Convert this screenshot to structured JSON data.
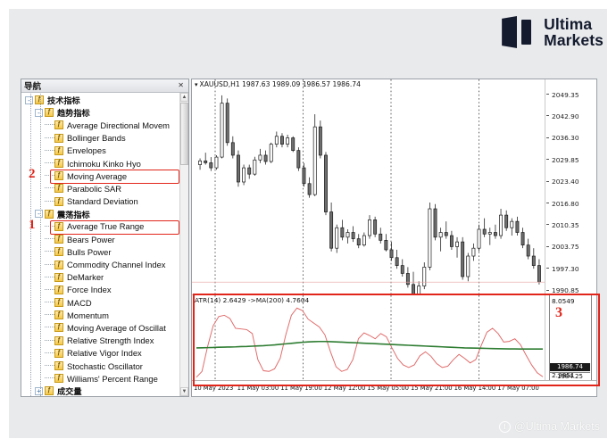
{
  "brand": {
    "name_line1": "Ultima",
    "name_line2": "Markets",
    "logo_color": "#141b2e",
    "watermark_text": "@Ultima Markets",
    "watermark_icon": "facebook-icon",
    "watermark_glyph": "f"
  },
  "navigator": {
    "title": "导航",
    "close_label": "✕",
    "scroll_up": "▲",
    "scroll_down": "▼",
    "tree": [
      {
        "label": "技术指标",
        "level": 0,
        "zh": true,
        "expander": "-"
      },
      {
        "label": "趋势指标",
        "level": 1,
        "zh": true,
        "expander": "-"
      },
      {
        "label": "Average Directional Movem",
        "level": 2,
        "zh": false
      },
      {
        "label": "Bollinger Bands",
        "level": 2,
        "zh": false
      },
      {
        "label": "Envelopes",
        "level": 2,
        "zh": false
      },
      {
        "label": "Ichimoku Kinko Hyo",
        "level": 2,
        "zh": false
      },
      {
        "label": "Moving Average",
        "level": 2,
        "zh": false,
        "highlight": 2
      },
      {
        "label": "Parabolic SAR",
        "level": 2,
        "zh": false
      },
      {
        "label": "Standard Deviation",
        "level": 2,
        "zh": false
      },
      {
        "label": "震荡指标",
        "level": 1,
        "zh": true,
        "expander": "-"
      },
      {
        "label": "Average True Range",
        "level": 2,
        "zh": false,
        "highlight": 1
      },
      {
        "label": "Bears Power",
        "level": 2,
        "zh": false
      },
      {
        "label": "Bulls Power",
        "level": 2,
        "zh": false
      },
      {
        "label": "Commodity Channel Index",
        "level": 2,
        "zh": false
      },
      {
        "label": "DeMarker",
        "level": 2,
        "zh": false
      },
      {
        "label": "Force Index",
        "level": 2,
        "zh": false
      },
      {
        "label": "MACD",
        "level": 2,
        "zh": false
      },
      {
        "label": "Momentum",
        "level": 2,
        "zh": false
      },
      {
        "label": "Moving Average of Oscillat",
        "level": 2,
        "zh": false
      },
      {
        "label": "Relative Strength Index",
        "level": 2,
        "zh": false
      },
      {
        "label": "Relative Vigor Index",
        "level": 2,
        "zh": false
      },
      {
        "label": "Stochastic Oscillator",
        "level": 2,
        "zh": false
      },
      {
        "label": "Williams' Percent Range",
        "level": 2,
        "zh": false
      },
      {
        "label": "成交量",
        "level": 1,
        "zh": true,
        "expander": "+"
      }
    ]
  },
  "annotations": {
    "one": "1",
    "two": "2",
    "three": "3",
    "color": "#e1251b"
  },
  "chart_data": {
    "type": "line",
    "title": "XAUUSD,H1  1987.63 1989.09 1986.57 1986.74",
    "symbol": "XAUUSD",
    "timeframe": "H1",
    "ohlc": {
      "open": "1987.63",
      "high": "1989.09",
      "low": "1986.57",
      "close": "1986.74"
    },
    "caret": "▾",
    "xlabel": "",
    "ylabel": "",
    "grid": true,
    "legend_position": "top-left",
    "price_axis": {
      "ticks": [
        "2049.35",
        "2042.90",
        "2036.30",
        "2029.85",
        "2023.40",
        "2016.80",
        "2010.35",
        "2003.75",
        "1997.30",
        "1990.85"
      ],
      "current_price": "1986.74",
      "next_level": "1984.25",
      "ylim": [
        1984.25,
        2049.35
      ]
    },
    "time_axis": {
      "labels": [
        "10 May 2023",
        "11 May 03:00",
        "11 May 19:00",
        "12 May 12:00",
        "15 May 05:00",
        "15 May 21:00",
        "16 May 14:00",
        "17 May 07:00"
      ]
    },
    "subwindow": {
      "label": "ATR(14) 2.6429  ->MA(200) 4.7604",
      "indicator": "ATR",
      "period": "14",
      "atr_value": "2.6429",
      "ma_label": "MA(200)",
      "ma_value": "4.7604",
      "scale_top": "8.0549",
      "scale_bottom": "2.3851",
      "ylim": [
        2.3851,
        8.0549
      ],
      "series": [
        {
          "name": "ATR(14)",
          "color": "#e06666",
          "values": [
            2.6,
            3.05,
            4.95,
            6.55,
            7.25,
            7.35,
            7.1,
            6.35,
            6.3,
            6.25,
            5.95,
            3.95,
            3.1,
            3.05,
            3.25,
            4.05,
            5.85,
            7.35,
            7.9,
            7.7,
            7.05,
            6.75,
            6.45,
            5.85,
            4.55,
            3.4,
            3.05,
            3.2,
            3.95,
            5.55,
            6.0,
            5.8,
            5.55,
            5.95,
            5.7,
            4.85,
            4.05,
            3.55,
            3.35,
            3.55,
            4.25,
            4.55,
            4.2,
            3.65,
            3.35,
            3.45,
            3.95,
            4.35,
            4.05,
            3.7,
            3.95,
            5.05,
            6.05,
            6.35,
            5.95,
            5.3,
            5.35,
            5.55,
            5.1,
            4.3,
            3.55,
            2.95,
            2.64
          ]
        },
        {
          "name": "MA(200)",
          "color": "#2e7d32",
          "values": [
            4.85,
            4.86,
            4.87,
            4.88,
            4.9,
            4.91,
            4.92,
            4.93,
            4.95,
            4.96,
            4.98,
            5.0,
            5.02,
            5.05,
            5.08,
            5.12,
            5.16,
            5.2,
            5.24,
            5.28,
            5.31,
            5.33,
            5.34,
            5.34,
            5.33,
            5.31,
            5.29,
            5.27,
            5.25,
            5.23,
            5.21,
            5.19,
            5.17,
            5.15,
            5.13,
            5.11,
            5.09,
            5.07,
            5.05,
            5.03,
            5.01,
            4.99,
            4.97,
            4.95,
            4.93,
            4.91,
            4.89,
            4.87,
            4.85,
            4.84,
            4.83,
            4.82,
            4.81,
            4.8,
            4.79,
            4.78,
            4.77,
            4.77,
            4.76,
            4.76,
            4.76,
            4.76,
            4.76
          ]
        }
      ]
    },
    "candles": [
      [
        2024.0,
        2026.0,
        2022.4,
        2025.2
      ],
      [
        2025.2,
        2027.8,
        2024.0,
        2024.6
      ],
      [
        2024.6,
        2026.4,
        2022.0,
        2023.0
      ],
      [
        2023.0,
        2027.0,
        2022.4,
        2026.4
      ],
      [
        2026.4,
        2046.0,
        2026.0,
        2043.5
      ],
      [
        2043.5,
        2045.0,
        2030.0,
        2031.0
      ],
      [
        2031.0,
        2033.0,
        2026.0,
        2027.0
      ],
      [
        2027.0,
        2028.5,
        2017.0,
        2018.5
      ],
      [
        2018.5,
        2024.0,
        2017.5,
        2023.0
      ],
      [
        2023.0,
        2024.0,
        2019.5,
        2021.0
      ],
      [
        2021.0,
        2026.5,
        2020.5,
        2025.5
      ],
      [
        2025.5,
        2029.0,
        2024.5,
        2027.0
      ],
      [
        2027.0,
        2028.5,
        2024.0,
        2025.0
      ],
      [
        2025.0,
        2031.0,
        2024.5,
        2030.5
      ],
      [
        2030.5,
        2034.5,
        2029.5,
        2033.0
      ],
      [
        2033.0,
        2034.0,
        2029.5,
        2030.5
      ],
      [
        2030.5,
        2033.5,
        2029.5,
        2032.5
      ],
      [
        2032.5,
        2033.0,
        2028.0,
        2028.5
      ],
      [
        2028.5,
        2029.5,
        2022.0,
        2023.0
      ],
      [
        2023.0,
        2024.5,
        2017.0,
        2018.0
      ],
      [
        2018.0,
        2020.0,
        2013.5,
        2014.5
      ],
      [
        2014.5,
        2040.0,
        2014.0,
        2036.0
      ],
      [
        2036.0,
        2038.0,
        2026.0,
        2027.0
      ],
      [
        2027.0,
        2028.0,
        2008.0,
        2009.0
      ],
      [
        2009.0,
        2012.0,
        1996.5,
        1997.5
      ],
      [
        1997.5,
        2005.0,
        1996.0,
        2004.0
      ],
      [
        2004.0,
        2006.5,
        2000.0,
        2001.0
      ],
      [
        2001.0,
        2003.5,
        1999.0,
        2002.5
      ],
      [
        2002.5,
        2004.5,
        1999.5,
        2000.5
      ],
      [
        2000.5,
        2002.0,
        1997.5,
        1998.5
      ],
      [
        1998.5,
        2002.5,
        1998.0,
        2001.5
      ],
      [
        2001.5,
        2008.0,
        2000.5,
        2006.5
      ],
      [
        2006.5,
        2007.5,
        2001.0,
        2002.0
      ],
      [
        2002.0,
        2004.0,
        1999.0,
        2000.0
      ],
      [
        2000.0,
        2002.0,
        1996.5,
        1997.0
      ],
      [
        1997.0,
        1999.5,
        1993.5,
        1994.5
      ],
      [
        1994.5,
        1997.0,
        1991.0,
        1992.0
      ],
      [
        1992.0,
        1994.0,
        1988.5,
        1989.5
      ],
      [
        1989.5,
        1991.5,
        1985.0,
        1986.0
      ],
      [
        1986.0,
        1990.0,
        1981.0,
        1982.0
      ],
      [
        1982.0,
        1987.0,
        1978.5,
        1985.5
      ],
      [
        1985.5,
        1993.0,
        1984.5,
        1991.5
      ],
      [
        1991.5,
        2012.0,
        1990.5,
        2010.0
      ],
      [
        2010.0,
        2011.5,
        2000.0,
        2001.0
      ],
      [
        2001.0,
        2004.0,
        1996.5,
        2002.5
      ],
      [
        2002.5,
        2006.0,
        2000.5,
        2001.5
      ],
      [
        2001.5,
        2003.0,
        1997.0,
        1998.0
      ],
      [
        1998.0,
        2001.0,
        1994.5,
        1999.5
      ],
      [
        1999.5,
        2001.0,
        1987.5,
        1988.5
      ],
      [
        1988.5,
        1996.0,
        1987.0,
        1995.0
      ],
      [
        1995.0,
        1999.0,
        1993.5,
        1997.5
      ],
      [
        1997.5,
        2005.0,
        1996.5,
        2003.5
      ],
      [
        2003.5,
        2007.0,
        2001.0,
        2002.0
      ],
      [
        2002.0,
        2004.0,
        1998.5,
        2002.5
      ],
      [
        2002.5,
        2005.0,
        2000.5,
        2001.5
      ],
      [
        2001.5,
        2010.0,
        2000.5,
        2008.0
      ],
      [
        2008.0,
        2009.5,
        2003.0,
        2004.0
      ],
      [
        2004.0,
        2007.0,
        2001.5,
        2006.0
      ],
      [
        2006.0,
        2007.5,
        2001.5,
        2002.5
      ],
      [
        2002.5,
        2004.0,
        1997.5,
        1998.5
      ],
      [
        1998.5,
        2000.5,
        1994.0,
        1995.0
      ],
      [
        1995.0,
        1997.5,
        1991.0,
        1992.0
      ],
      [
        1992.0,
        1994.0,
        1986.0,
        1986.74
      ]
    ]
  }
}
